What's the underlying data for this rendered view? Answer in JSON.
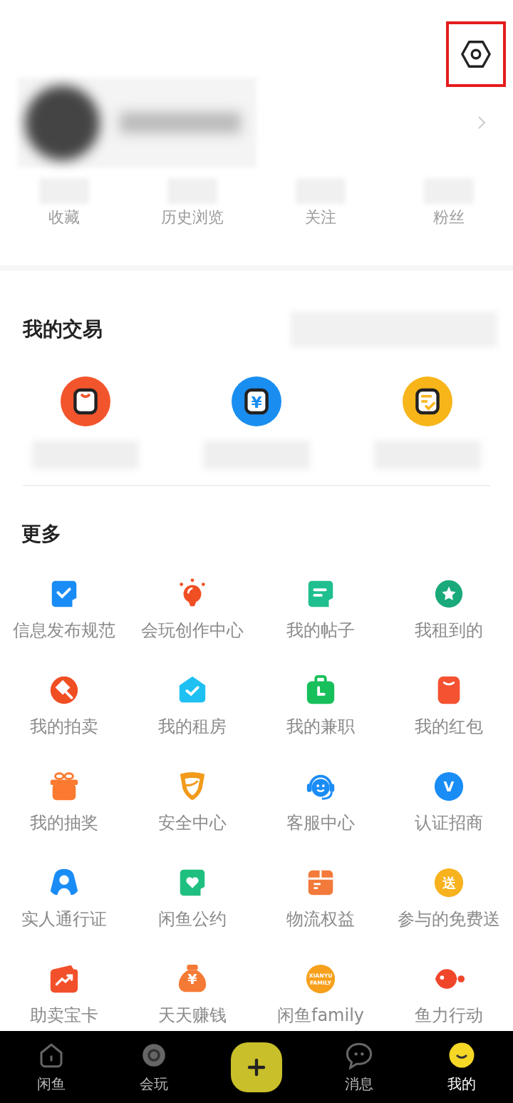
{
  "header": {
    "settings_highlighted": true
  },
  "profile": {
    "kind": "blurred"
  },
  "stats": [
    {
      "label": "收藏"
    },
    {
      "label": "历史浏览"
    },
    {
      "label": "关注"
    },
    {
      "label": "粉丝"
    }
  ],
  "trade": {
    "title": "我的交易",
    "items": [
      {
        "kind": "bag",
        "color": "#f2552c"
      },
      {
        "kind": "yuan",
        "color": "#1a8ef0",
        "glyph": [
          "¥"
        ]
      },
      {
        "kind": "doc",
        "color": "#f7b51a"
      }
    ]
  },
  "more": {
    "title": "更多",
    "items": [
      {
        "label": "信息发布规范",
        "kind": "check-note",
        "color": "#1a8cf5"
      },
      {
        "label": "会玩创作中心",
        "kind": "bulb",
        "color": "#f04e23"
      },
      {
        "label": "我的帖子",
        "kind": "note",
        "color": "#1fbf8f"
      },
      {
        "label": "我租到的",
        "kind": "star-circle",
        "color": "#1aa97a"
      },
      {
        "label": "我的拍卖",
        "kind": "hammer-circle",
        "color": "#f04e23"
      },
      {
        "label": "我的租房",
        "kind": "house-check",
        "color": "#1ec0f2"
      },
      {
        "label": "我的兼职",
        "kind": "briefcase",
        "color": "#17c05a"
      },
      {
        "label": "我的红包",
        "kind": "packet",
        "color": "#f45231"
      },
      {
        "label": "我的抽奖",
        "kind": "gift",
        "color": "#fb7a2f"
      },
      {
        "label": "安全中心",
        "kind": "shield",
        "color": "#f29a1a"
      },
      {
        "label": "客服中心",
        "kind": "headset",
        "color": "#1a8cf5"
      },
      {
        "label": "认证招商",
        "kind": "glyph-circle",
        "color": "#1a8cf5",
        "glyph": [
          "V"
        ]
      },
      {
        "label": "实人通行证",
        "kind": "person",
        "color": "#1a8cf5"
      },
      {
        "label": "闲鱼公约",
        "kind": "heart-note",
        "color": "#1fbf7f"
      },
      {
        "label": "物流权益",
        "kind": "box",
        "color": "#f27a3a"
      },
      {
        "label": "参与的免费送",
        "kind": "glyph-circle",
        "color": "#f7b21d",
        "glyph": [
          "送"
        ]
      },
      {
        "label": "助卖宝卡",
        "kind": "chart-bag",
        "color": "#f2502a"
      },
      {
        "label": "天天赚钱",
        "kind": "money-bag",
        "color": "#f57a35",
        "glyph": [
          "¥"
        ]
      },
      {
        "label": "闲鱼family",
        "kind": "glyph-circle",
        "color": "#f7a01c",
        "glyph": [
          "XIANYU",
          "FAMILY"
        ]
      },
      {
        "label": "鱼力行动",
        "kind": "fish",
        "color": "#f0462a"
      }
    ]
  },
  "tabbar": [
    {
      "label": "闲鱼",
      "kind": "house",
      "selected": false
    },
    {
      "label": "会玩",
      "kind": "ring",
      "selected": false
    },
    {
      "kind": "post",
      "selected": false
    },
    {
      "label": "消息",
      "kind": "chat",
      "selected": false
    },
    {
      "label": "我的",
      "kind": "avatar",
      "selected": true
    }
  ]
}
